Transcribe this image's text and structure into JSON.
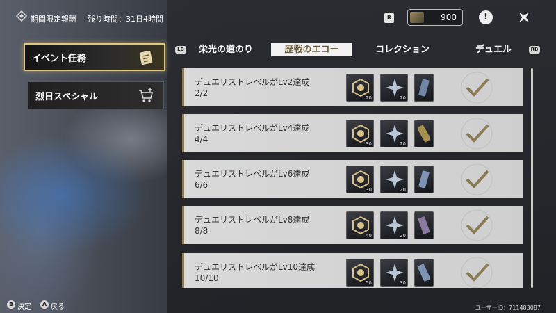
{
  "header": {
    "title": "期間限定報酬",
    "remaining": "残り時間：31日4時間",
    "small_badge": "R",
    "currency_value": "900",
    "alert_label": "!"
  },
  "menu": [
    {
      "label": "イベント任務",
      "active": true
    },
    {
      "label": "烈日スペシャル",
      "active": false
    }
  ],
  "tabs": {
    "lb": "LB",
    "rb": "RB",
    "items": [
      {
        "label": "栄光の道のり"
      },
      {
        "label": "歴戦のエコー"
      },
      {
        "label": "コレクション"
      },
      {
        "label": "デュエル"
      }
    ]
  },
  "missions": [
    {
      "title": "デュエリストレベルがLv2達成",
      "progress": "2/2",
      "rewards": [
        {
          "icon": "emblem-icon",
          "count": "20"
        },
        {
          "icon": "star-shard-icon",
          "count": "20"
        },
        {
          "icon": "ticket-icon",
          "count": ""
        }
      ]
    },
    {
      "title": "デュエリストレベルがLv4達成",
      "progress": "4/4",
      "rewards": [
        {
          "icon": "emblem-icon",
          "count": "30"
        },
        {
          "icon": "star-shard-icon",
          "count": "20"
        },
        {
          "icon": "ticket-icon",
          "count": ""
        }
      ]
    },
    {
      "title": "デュエリストレベルがLv6達成",
      "progress": "6/6",
      "rewards": [
        {
          "icon": "emblem-icon",
          "count": "30"
        },
        {
          "icon": "star-shard-icon",
          "count": "20"
        },
        {
          "icon": "ticket-icon",
          "count": ""
        }
      ]
    },
    {
      "title": "デュエリストレベルがLv8達成",
      "progress": "8/8",
      "rewards": [
        {
          "icon": "emblem-icon",
          "count": "40"
        },
        {
          "icon": "star-shard-icon",
          "count": "20"
        },
        {
          "icon": "ticket-icon",
          "count": ""
        }
      ]
    },
    {
      "title": "デュエリストレベルがLv10達成",
      "progress": "10/10",
      "rewards": [
        {
          "icon": "emblem-icon",
          "count": "50"
        },
        {
          "icon": "star-shard-icon",
          "count": "30"
        },
        {
          "icon": "ticket-icon",
          "count": ""
        }
      ]
    }
  ],
  "footer": {
    "b_button": "B",
    "b_label": "決定",
    "a_button": "A",
    "a_label": "戻る",
    "user_id": "ユーザーID：711483087"
  },
  "colors": {
    "accent_gold": "#e0c57a",
    "check_color": "#8a7a55"
  }
}
